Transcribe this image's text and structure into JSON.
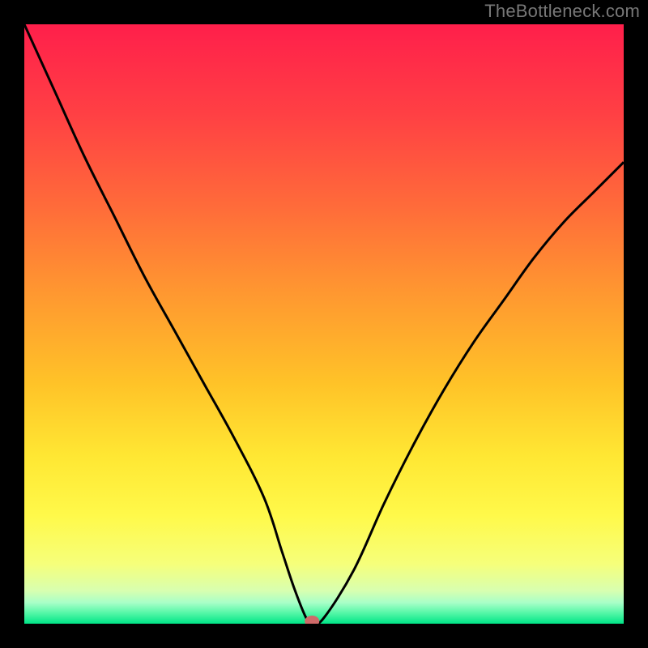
{
  "watermark": "TheBottleneck.com",
  "chart_data": {
    "type": "line",
    "title": "",
    "xlabel": "",
    "ylabel": "",
    "xlim": [
      0,
      100
    ],
    "ylim": [
      0,
      100
    ],
    "x": [
      0,
      5,
      10,
      15,
      20,
      25,
      30,
      35,
      40,
      43,
      45,
      47,
      48,
      50,
      55,
      60,
      65,
      70,
      75,
      80,
      85,
      90,
      95,
      100
    ],
    "values": [
      100,
      89,
      78,
      68,
      58,
      49,
      40,
      31,
      21,
      12,
      6,
      1,
      0,
      1,
      9,
      20,
      30,
      39,
      47,
      54,
      61,
      67,
      72,
      77
    ],
    "optimum_x": 48,
    "optimum_y": 0,
    "gradient_stops": [
      {
        "offset": 0.0,
        "color": "#ff1f4b"
      },
      {
        "offset": 0.15,
        "color": "#ff4044"
      },
      {
        "offset": 0.3,
        "color": "#ff6a3a"
      },
      {
        "offset": 0.45,
        "color": "#ff9830"
      },
      {
        "offset": 0.6,
        "color": "#ffc328"
      },
      {
        "offset": 0.72,
        "color": "#ffe733"
      },
      {
        "offset": 0.82,
        "color": "#fff94a"
      },
      {
        "offset": 0.9,
        "color": "#f6ff7a"
      },
      {
        "offset": 0.945,
        "color": "#d8ffb0"
      },
      {
        "offset": 0.965,
        "color": "#a8ffc8"
      },
      {
        "offset": 0.982,
        "color": "#55f7a7"
      },
      {
        "offset": 1.0,
        "color": "#00e587"
      }
    ],
    "marker_color": "#cf6a69",
    "curve_color": "#000000"
  }
}
